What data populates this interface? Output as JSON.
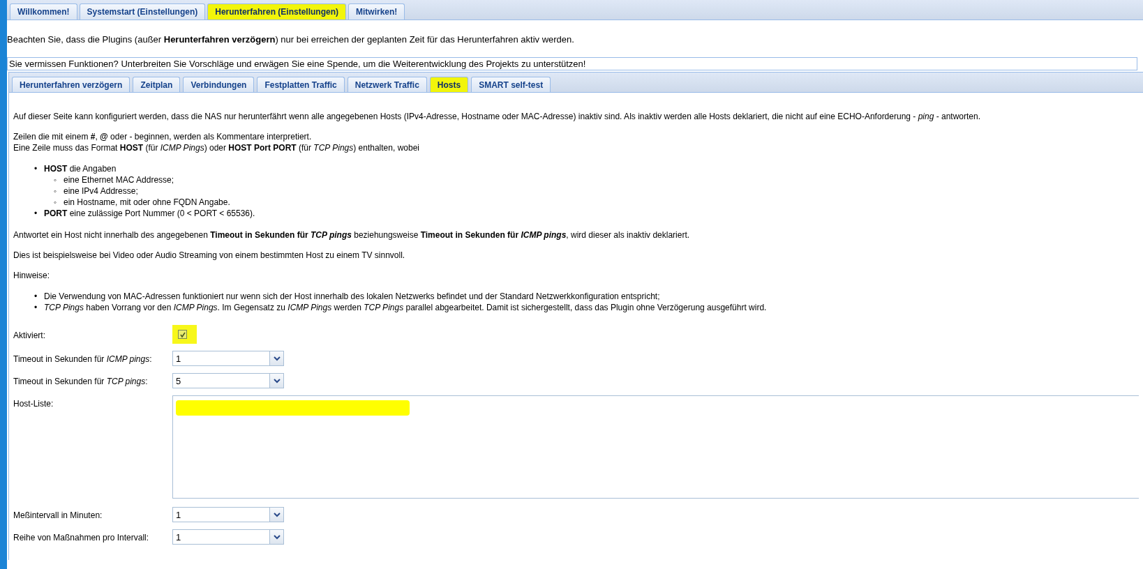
{
  "top_tabs": [
    {
      "label": "Willkommen!",
      "selected": false
    },
    {
      "label": "Systemstart (Einstellungen)",
      "selected": false
    },
    {
      "label": "Herunterfahren (Einstellungen)",
      "selected": true
    },
    {
      "label": "Mitwirken!",
      "selected": false
    }
  ],
  "note": "Beachten Sie, dass die Plugins (außer **Herunterfahren verzögern**) nur bei erreichen der geplanten Zeit für das Herunterfahren aktiv werden.",
  "banner": "Sie vermissen Funktionen? Unterbreiten Sie Vorschläge und erwägen Sie eine Spende, um die Weiterentwicklung des Projekts zu unterstützen!",
  "plugin_tabs": [
    {
      "label": "Herunterfahren verzögern",
      "selected": false
    },
    {
      "label": "Zeitplan",
      "selected": false
    },
    {
      "label": "Verbindungen",
      "selected": false
    },
    {
      "label": "Festplatten Traffic",
      "selected": false
    },
    {
      "label": "Netzwerk Traffic",
      "selected": false
    },
    {
      "label": "Hosts",
      "selected": true
    },
    {
      "label": "SMART self-test",
      "selected": false
    }
  ],
  "intro": "Auf dieser Seite kann konfiguriert werden, dass die NAS nur herunterfährt wenn alle angegebenen Hosts (IPv4-Adresse, Hostname oder MAC-Adresse) inaktiv sind. Als inaktiv werden alle Hosts deklariert, die nicht auf eine ECHO-Anforderung - *ping* - antworten.",
  "format_lines": [
    "Zeilen die mit einem **#**, **@** oder - beginnen, werden als Kommentare interpretiert.",
    "Eine Zeile muss das Format **HOST** (für *ICMP Pings*) oder **HOST Port PORT** (für *TCP Pings*) enthalten, wobei"
  ],
  "format_list": [
    {
      "marker": "•",
      "text": "**HOST** die Angaben",
      "children": [
        {
          "marker": "◦",
          "text": "eine Ethernet MAC Addresse;"
        },
        {
          "marker": "◦",
          "text": "eine IPv4 Addresse;"
        },
        {
          "marker": "◦",
          "text": "ein Hostname, mit oder ohne FQDN Angabe."
        }
      ]
    },
    {
      "marker": "•",
      "text": "**PORT** eine zulässige Port Nummer (0 < PORT < 65536)."
    }
  ],
  "paragraphs": [
    "Antwortet ein Host nicht innerhalb des angegebenen **Timeout in Sekunden für** *TCP pings* beziehungsweise **Timeout in Sekunden für** *ICMP pings*, wird dieser als inaktiv deklariert.",
    "Dies ist beispielsweise bei Video oder Audio Streaming von einem bestimmten Host zu einem TV sinnvoll.",
    "Hinweise:"
  ],
  "hints": [
    {
      "marker": "•",
      "text": "Die Verwendung von MAC-Adressen funktioniert nur wenn sich der Host innerhalb des lokalen Netzwerks befindet und der Standard Netzwerkkonfiguration entspricht;"
    },
    {
      "marker": "•",
      "text": "*TCP Pings* haben Vorrang vor den *ICMP Pings*. Im Gegensatz zu *ICMP Pings* werden *TCP Pings* parallel abgearbeitet. Damit ist sichergestellt, dass das Plugin ohne Verzögerung ausgeführt wird."
    }
  ],
  "form": [
    {
      "kind": "checkbox",
      "label": "Aktiviert:",
      "checked": true
    },
    {
      "kind": "select",
      "label": "Timeout in Sekunden für *ICMP pings*:",
      "value": "1"
    },
    {
      "kind": "select",
      "label": "Timeout in Sekunden für *TCP pings*:",
      "value": "5"
    },
    {
      "kind": "textarea",
      "label": "Host-Liste:",
      "redacted": true
    },
    {
      "kind": "select",
      "label": "Meßintervall in Minuten:",
      "value": "1"
    },
    {
      "kind": "select",
      "label": "Reihe von Maßnahmen pro Intervall:",
      "value": "1"
    }
  ]
}
